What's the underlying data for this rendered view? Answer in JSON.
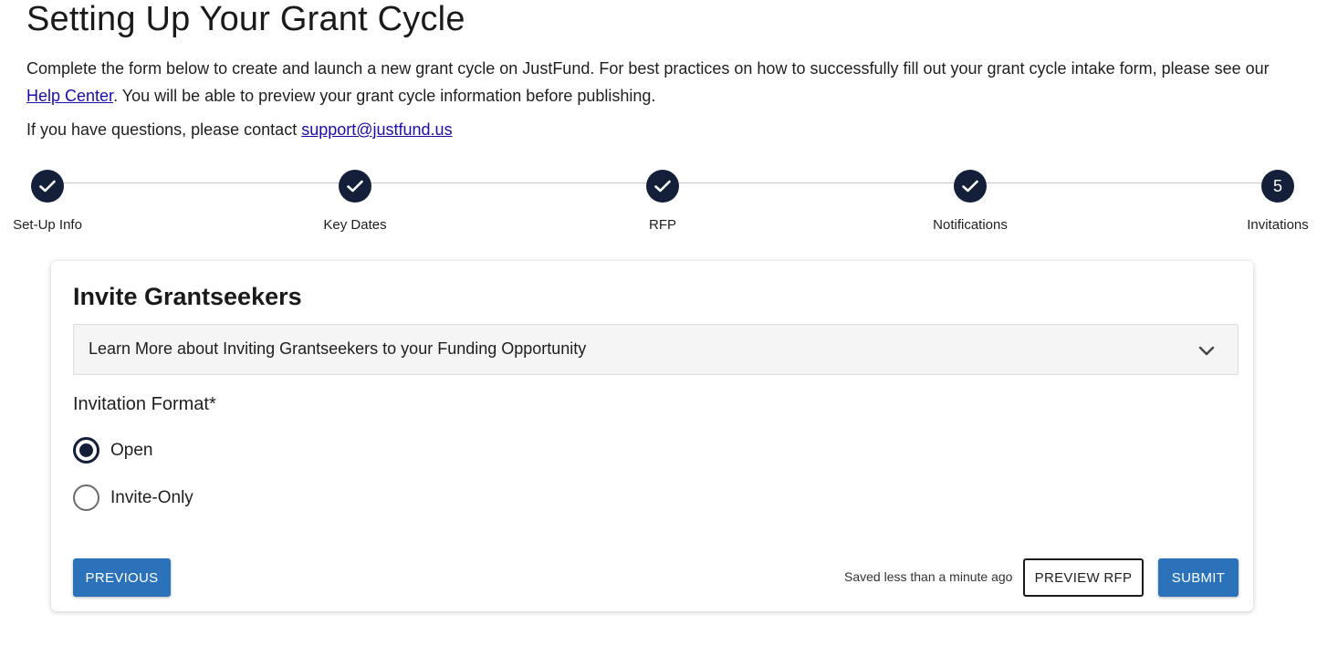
{
  "header": {
    "title": "Setting Up Your Grant Cycle",
    "intro_before_link": "Complete the form below to create and launch a new grant cycle on JustFund. For best practices on how to successfully fill out your grant cycle intake form, please see our ",
    "help_link": "Help Center",
    "intro_after_link": ". You will be able to preview your grant cycle information before publishing.",
    "contact_prefix": "If you have questions, please contact ",
    "contact_email": "support@justfund.us"
  },
  "stepper": {
    "steps": [
      {
        "label": "Set-Up Info",
        "state": "completed",
        "icon": "check-icon"
      },
      {
        "label": "Key Dates",
        "state": "completed",
        "icon": "check-icon"
      },
      {
        "label": "RFP",
        "state": "completed",
        "icon": "check-icon"
      },
      {
        "label": "Notifications",
        "state": "completed",
        "icon": "check-icon"
      },
      {
        "label": "Invitations",
        "state": "active",
        "number": "5"
      }
    ]
  },
  "card": {
    "title": "Invite Grantseekers",
    "accordion_label": "Learn More about Inviting Grantseekers to your Funding Opportunity",
    "field_label": "Invitation Format*",
    "options": [
      {
        "label": "Open",
        "selected": true
      },
      {
        "label": "Invite-Only",
        "selected": false
      }
    ]
  },
  "footer": {
    "previous_label": "PREVIOUS",
    "saved_status": "Saved less than a minute ago",
    "preview_label": "PREVIEW RFP",
    "submit_label": "SUBMIT"
  },
  "colors": {
    "step_circle": "#14203a",
    "primary_button": "#2b72ba",
    "link": "#1a0dab"
  }
}
